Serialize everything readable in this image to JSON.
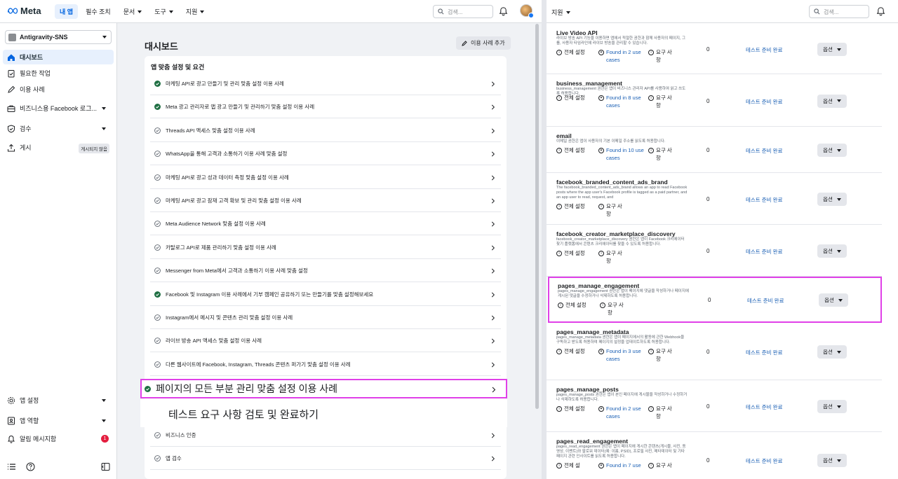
{
  "topbar": {
    "brand": "Meta",
    "nav": [
      {
        "label": "내 앱",
        "active": true
      },
      {
        "label": "필수 조치",
        "active": false
      },
      {
        "label": "문서",
        "dropdown": true
      },
      {
        "label": "도구",
        "dropdown": true
      },
      {
        "label": "지원",
        "dropdown": true
      }
    ],
    "search_placeholder": "검색..."
  },
  "sidebar": {
    "app_name": "Antigravity-SNS",
    "items": [
      {
        "label": "대시보드"
      },
      {
        "label": "필요한 작업"
      },
      {
        "label": "이용 사례"
      },
      {
        "label": "비즈니스용 Facebook 로그..."
      },
      {
        "label": "검수"
      },
      {
        "label": "게시",
        "badge": "게시되지 않음"
      }
    ],
    "bottom_items": [
      {
        "label": "앱 설정"
      },
      {
        "label": "앱 역할"
      },
      {
        "label": "알림 메시지함",
        "count": "1"
      }
    ]
  },
  "main": {
    "title": "대시보드",
    "add_use_case": "이용 사례 추가",
    "card_title": "앱 맞춤 설정 및 요건",
    "rows": [
      {
        "label": "마케팅 API로 광고 만들기 및 관리 맞춤 설정 이용 사례",
        "done": true
      },
      {
        "label": "Meta 광고 관리자로 앱 광고 만들기 및 관리하기 맞춤 설정 이용 사례",
        "done": true
      },
      {
        "label": "Threads API 액세스 맞춤 설정 이용 사례",
        "done": false
      },
      {
        "label": "WhatsApp을 통해 고객과 소통하기 이용 사례 맞춤 설정",
        "done": false
      },
      {
        "label": "마케팅 API로 광고 성과 데이터 측정 맞춤 설정 이용 사례",
        "done": false
      },
      {
        "label": "마케팅 API로 광고 잠재 고객 확보 및 관리 맞춤 설정 이용 사례",
        "done": false
      },
      {
        "label": "Meta Audience Network 맞춤 설정 이용 사례",
        "done": false
      },
      {
        "label": "카탈로그 API로 제품 관리하기 맞춤 설정 이용 사례",
        "done": false
      },
      {
        "label": "Messenger from Meta에서 고객과 소통하기 이용 사례 맞춤 설정",
        "done": false
      },
      {
        "label": "Facebook 및 Instagram 이용 사례에서 기부 캠페인 공유하기 또는 만들기를 맞춤 설정해보세요",
        "done": true
      },
      {
        "label": "Instagram에서 메시지 및 콘텐츠 관리 맞춤 설정 이용 사례",
        "done": false
      },
      {
        "label": "라이브 방송 API 액세스 맞춤 설정 이용 사례",
        "done": false
      },
      {
        "label": "다른 웹사이트에 Facebook, Instagram, Threads 콘텐츠 퍼가기 맞춤 설정 이용 사례",
        "done": false
      }
    ],
    "highlight_row": "페이지의 모든 부분 관리 맞춤 설정 이용 사례",
    "overlay_text": "테스트 요구 사항 검토 및 완료하기",
    "bottom_rows": [
      {
        "label": "비즈니스 인증"
      },
      {
        "label": "앱 검수"
      }
    ]
  },
  "right_panel": {
    "nav_label": "지원",
    "search_placeholder": "검색...",
    "permissions": [
      {
        "name": "Live Video API",
        "desc": "라이브 방송 API 기능을 이용하면 앱에서 적절한 권한과 함께 사용자의 페이지, 그룹, 사용자 타임라인에 라이브 방송을 관리할 수 있습니다.",
        "settings": "전체 설정",
        "found": "Found in 2 use cases",
        "req": "요구 사항",
        "count": "0",
        "status": "테스트 준비 완료",
        "option": "옵션"
      },
      {
        "name": "business_management",
        "desc": "business_management 권한은 앱이 비즈니스 관리자 API를 사용하여 읽고 쓰도록 허용합니다.",
        "settings": "전체 설정",
        "found": "Found in 8 use cases",
        "req": "요구 사항",
        "count": "0",
        "status": "테스트 준비 완료",
        "option": "옵션"
      },
      {
        "name": "email",
        "desc": "이메일 권한은 앱이 사용자의 기본 이메일 주소를 읽도록 허용합니다.",
        "settings": "전체 설정",
        "found": "Found in 10 use cases",
        "req": "요구 사항",
        "count": "0",
        "status": "테스트 준비 완료",
        "option": "옵션"
      },
      {
        "name": "facebook_branded_content_ads_brand",
        "desc": "The facebook_branded_content_ads_brand allows an app to read Facebook posts where the app user's Facebook profile is tagged as a paid partner, and an app user to read, request, and",
        "settings": "전체 설정",
        "found": "",
        "req": "요구 사항",
        "count": "0",
        "status": "테스트 준비 완료",
        "option": "옵션"
      },
      {
        "name": "facebook_creator_marketplace_discovery",
        "desc": "facebook_creator_marketplace_discovery 권한은 앱이 Facebook 크리에이터 찾기 플랫폼에서 콘텐츠 크리에이터를 찾을 수 있도록 허용합니다.",
        "settings": "전체 설정",
        "found": "",
        "req": "요구 사항",
        "count": "0",
        "status": "테스트 준비 완료",
        "option": "옵션"
      },
      {
        "name": "pages_manage_engagement",
        "desc": "pages_manage_engagement 권한은 앱이 페이지에 댓글을 작성하거나 페이지에 게시된 댓글을 수정하거나 삭제하도록 허용합니다.",
        "settings": "전체 설정",
        "found": "",
        "req": "요구 사항",
        "count": "0",
        "status": "테스트 준비 완료",
        "option": "옵션",
        "selected": true
      },
      {
        "name": "pages_manage_metadata",
        "desc": "pages_manage_metadata 권한은 앱이 페이지에서의 활동에 관한 Webhook을 구독하고 받도록 허용하며 페이지의 설정을 업데이트하도록 허용합니다.",
        "settings": "전체 설정",
        "found": "Found in 3 use cases",
        "req": "요구 사항",
        "count": "0",
        "status": "테스트 준비 완료",
        "option": "옵션"
      },
      {
        "name": "pages_manage_posts",
        "desc": "pages_manage_posts 권한은 앱이 본인 페이지에 게시물을 작성하거나 수정하거나 삭제하도록 허용합니다.",
        "settings": "전체 설정",
        "found": "Found in 2 use cases",
        "req": "요구 사항",
        "count": "0",
        "status": "테스트 준비 완료",
        "option": "옵션"
      },
      {
        "name": "pages_read_engagement",
        "desc": "pages_read_engagement 권한은 앱이 페이지에 게시한 콘텐츠(게시물, 사진, 동영상, 이벤트)와 팔로워 데이터(예: 이름, PSID), 프로필 사진, 메타데이터 및 기타 페이지 관련 인사이트를 읽도록 허용합니다.",
        "settings": "전체 설",
        "found": "Found in 7 use",
        "req": "요구 사",
        "count": "0",
        "status": "테스트 준비 완료",
        "option": "옵션"
      }
    ]
  },
  "colors": {
    "accent": "#0064e0",
    "done": "#1f6f43",
    "highlight": "#e040e8",
    "link": "#1a5fb4"
  }
}
